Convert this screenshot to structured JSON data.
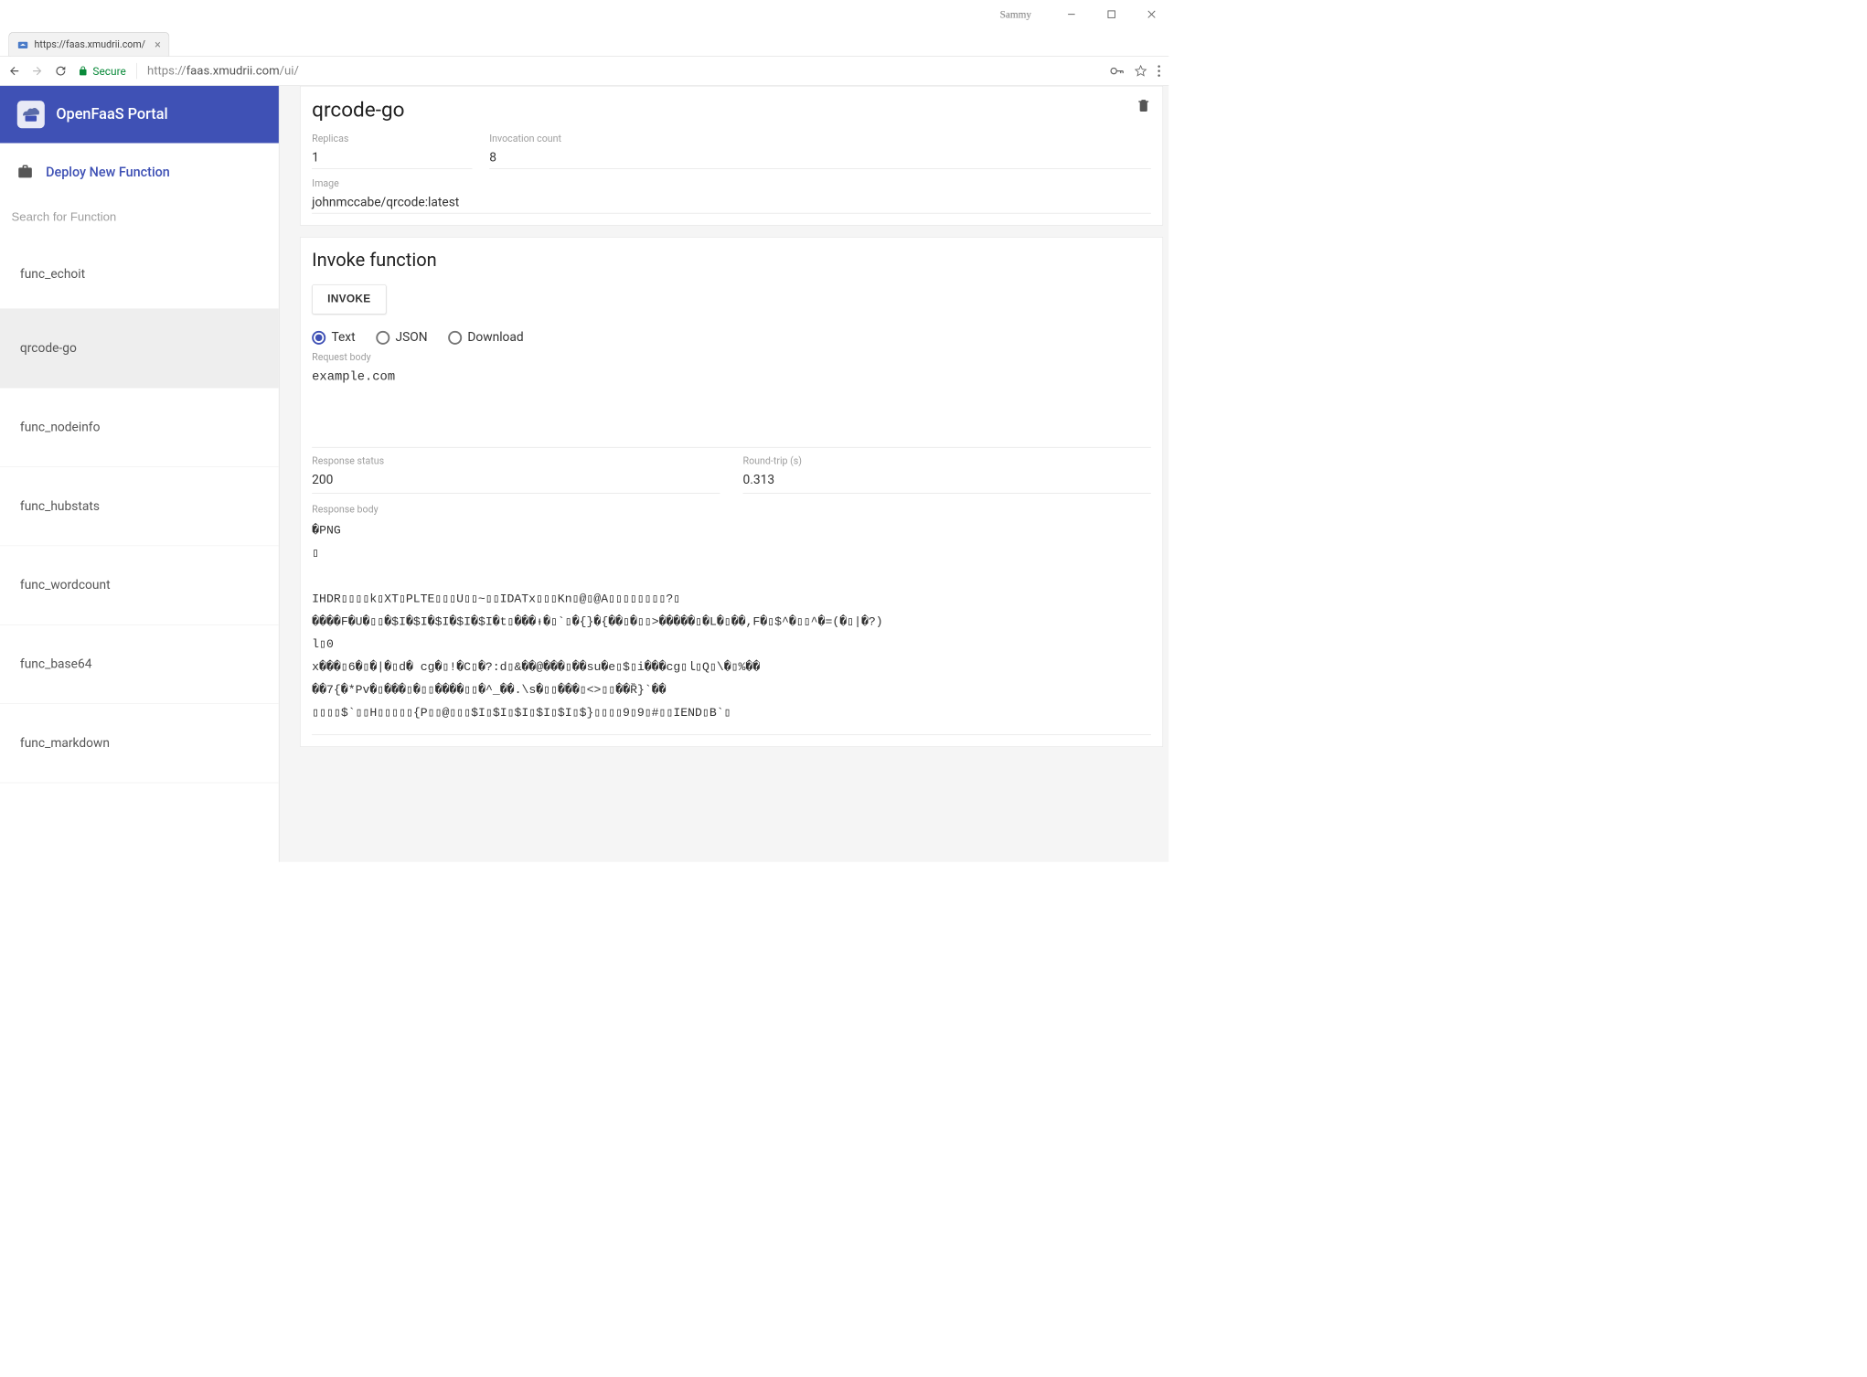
{
  "window": {
    "username": "Sammy"
  },
  "tab": {
    "title": "https://faas.xmudrii.com/"
  },
  "addressbar": {
    "secure_label": "Secure",
    "url_full": "https://faas.xmudrii.com/ui/",
    "url_host": "faas.xmudrii.com",
    "url_path": "/ui/"
  },
  "brand": {
    "title": "OpenFaaS Portal"
  },
  "sidebar": {
    "deploy_label": "Deploy New Function",
    "search_placeholder": "Search for Function",
    "items": [
      {
        "label": "func_echoit",
        "selected": false
      },
      {
        "label": "qrcode-go",
        "selected": true
      },
      {
        "label": "func_nodeinfo",
        "selected": false
      },
      {
        "label": "func_hubstats",
        "selected": false
      },
      {
        "label": "func_wordcount",
        "selected": false
      },
      {
        "label": "func_base64",
        "selected": false
      },
      {
        "label": "func_markdown",
        "selected": false
      }
    ]
  },
  "function": {
    "name": "qrcode-go",
    "replicas_label": "Replicas",
    "replicas_value": "1",
    "invocation_label": "Invocation count",
    "invocation_value": "8",
    "image_label": "Image",
    "image_value": "johnmccabe/qrcode:latest"
  },
  "invoke": {
    "title": "Invoke function",
    "button_label": "INVOKE",
    "radio_text": "Text",
    "radio_json": "JSON",
    "radio_download": "Download",
    "request_body_label": "Request body",
    "request_body": "example.com",
    "response_status_label": "Response status",
    "response_status": "200",
    "roundtrip_label": "Round-trip (s)",
    "roundtrip_value": "0.313",
    "response_body_label": "Response body",
    "response_body": "�PNG\n▯\n\nIHDR▯▯▯▯k▯XT▯PLTE▯▯▯U▯▯~▯▯IDATx▯▯▯Kn▯@▯@A▯▯▯▯▯▯▯▯?▯\n����F�U�▯▯�$I�$I�$I�$I�$I�t▯���ᵻ�▯`▯�{}�{��▯�▯▯>�����▯�L�▯��,F�▯$^�▯▯^�=(�▯|�?)\nl▯0\nx���▯6�▯�|�▯d� cg�▯!�C▯�?:d▯&��@���▯��su�e▯$▯i���cg▯ﺎ▯Q▯\\�▯%��\n��7{�*Pv�▯���▯�▯▯����▯▯�^_��.\\s�▯▯���▯<>▯▯��Ȑ}`��\n▯▯▯▯$`▯▯H▯▯▯▯▯{P▯▯@▯▯▯$I▯$I▯$I▯$I▯$I▯$}▯▯▯▯9▯9▯#▯▯IEND▯B`▯"
  }
}
